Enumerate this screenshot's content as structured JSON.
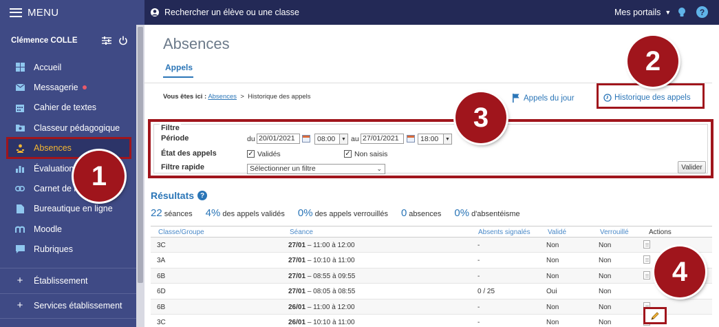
{
  "topbar": {
    "menu_label": "MENU",
    "search_label": "Rechercher un élève ou une classe",
    "portals_label": "Mes portails"
  },
  "sidebar": {
    "user_name": "Clémence COLLE",
    "items": [
      {
        "label": "Accueil",
        "icon": "grid-icon"
      },
      {
        "label": "Messagerie",
        "icon": "mail-icon"
      },
      {
        "label": "Cahier de textes",
        "icon": "calendar-icon"
      },
      {
        "label": "Classeur pédagogique",
        "icon": "folder-icon"
      },
      {
        "label": "Absences",
        "icon": "people-icon"
      },
      {
        "label": "Évaluation",
        "icon": "bar-chart-icon"
      },
      {
        "label": "Carnet de l",
        "icon": "link-icon"
      },
      {
        "label": "Bureautique en ligne",
        "icon": "document-icon"
      },
      {
        "label": "Moodle",
        "icon": "moodle-icon"
      },
      {
        "label": "Rubriques",
        "icon": "comment-icon"
      }
    ],
    "etablissement": "Établissement",
    "services": "Services établissement"
  },
  "main": {
    "title": "Absences",
    "tab": "Appels",
    "breadcrumb": {
      "prefix": "Vous êtes ici :",
      "link": "Absences",
      "sep": ">",
      "current": "Historique des appels"
    },
    "appels_jour": "Appels du jour",
    "historique": "Historique des appels"
  },
  "filter": {
    "title": "Filtre",
    "periode_label": "Période",
    "du": "du",
    "date_from": "20/01/2021",
    "time_from": "08:00",
    "au": "au",
    "date_to": "27/01/2021",
    "time_to": "18:00",
    "etat_label": "État des appels",
    "valides": "Validés",
    "non_saisis": "Non saisis",
    "rapide_label": "Filtre rapide",
    "rapide_value": "Sélectionner un filtre",
    "valider": "Valider"
  },
  "results": {
    "title": "Résultats",
    "stats": [
      {
        "num": "22",
        "label": "séances"
      },
      {
        "num": "4%",
        "label": "des appels validés"
      },
      {
        "num": "0%",
        "label": "des appels verrouillés"
      },
      {
        "num": "0",
        "label": "absences"
      },
      {
        "num": "0%",
        "label": "d'absentéisme"
      }
    ],
    "headers": {
      "classe": "Classe/Groupe",
      "seance": "Séance",
      "absents": "Absents signalés",
      "valide": "Validé",
      "verrouille": "Verrouillé",
      "actions": "Actions"
    },
    "rows": [
      {
        "classe": "3C",
        "date": "27/01",
        "time": "– 11:00 à 12:00",
        "absents": "-",
        "valide": "Non",
        "verrouille": "Non"
      },
      {
        "classe": "3A",
        "date": "27/01",
        "time": "– 10:10 à 11:00",
        "absents": "-",
        "valide": "Non",
        "verrouille": "Non"
      },
      {
        "classe": "6B",
        "date": "27/01",
        "time": "– 08:55 à 09:55",
        "absents": "-",
        "valide": "Non",
        "verrouille": "Non"
      },
      {
        "classe": "6D",
        "date": "27/01",
        "time": "– 08:05 à 08:55",
        "absents": "0 / 25",
        "valide": "Oui",
        "verrouille": "Non"
      },
      {
        "classe": "6B",
        "date": "26/01",
        "time": "– 11:00 à 12:00",
        "absents": "-",
        "valide": "Non",
        "verrouille": "Non"
      },
      {
        "classe": "3C",
        "date": "26/01",
        "time": "– 10:10 à 11:00",
        "absents": "-",
        "valide": "Non",
        "verrouille": "Non"
      }
    ]
  },
  "badges": {
    "one": "1",
    "two": "2",
    "three": "3",
    "four": "4"
  },
  "colors": {
    "accent": "#2a75b7",
    "sidebar": "#3f4a85",
    "topbar": "#232956",
    "highlight": "#a0151c",
    "active_text": "#f4b731"
  }
}
